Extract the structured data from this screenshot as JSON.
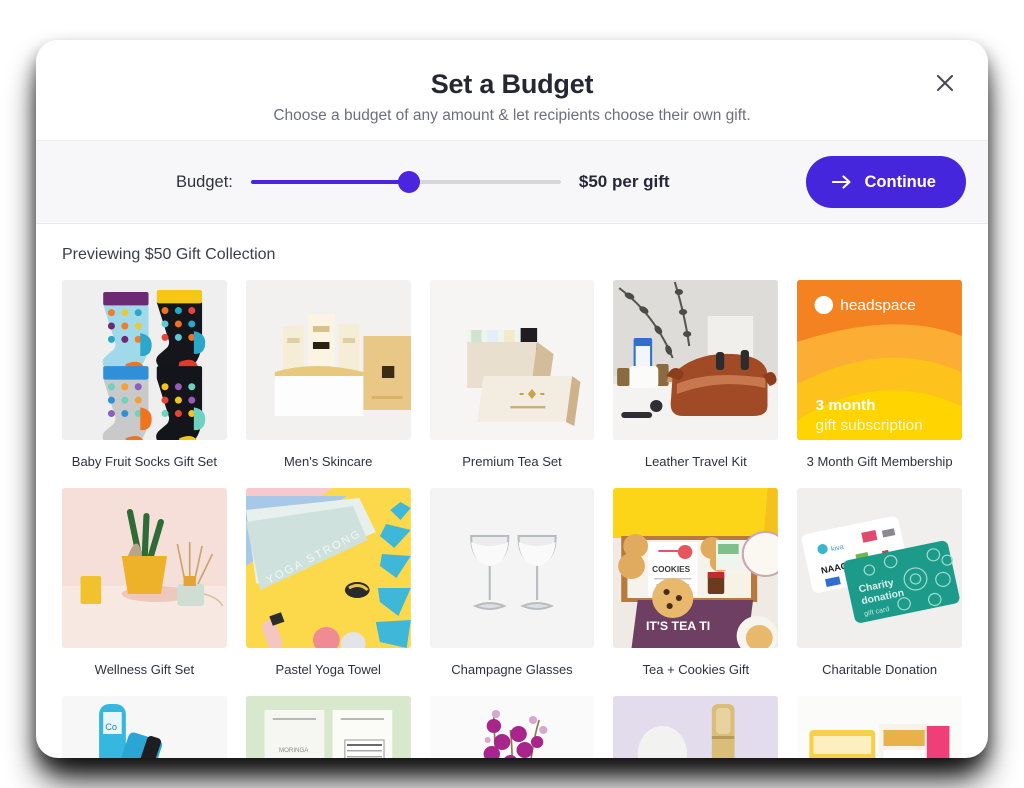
{
  "modal": {
    "title": "Set a Budget",
    "subtitle": "Choose a budget of any amount & let recipients choose their own gift.",
    "close_icon": "close-icon"
  },
  "budget": {
    "label": "Budget:",
    "value_text": "$50 per gift",
    "amount": 50,
    "slider_percent": 51,
    "accent_color": "#4c24e0",
    "track_color": "#d7d7da"
  },
  "continue": {
    "label": "Continue",
    "icon": "arrow-right-icon",
    "color": "#4526dd"
  },
  "preview": {
    "title": "Previewing $50 Gift Collection"
  },
  "gifts": [
    {
      "name": "Baby Fruit Socks Gift Set",
      "art": "socks"
    },
    {
      "name": "Men's Skincare",
      "art": "skincare"
    },
    {
      "name": "Premium Tea Set",
      "art": "tea"
    },
    {
      "name": "Leather Travel Kit",
      "art": "dopp"
    },
    {
      "name": "3 Month Gift Membership",
      "art": "headspace"
    },
    {
      "name": "Wellness Gift Set",
      "art": "wellness"
    },
    {
      "name": "Pastel Yoga Towel",
      "art": "yoga"
    },
    {
      "name": "Champagne Glasses",
      "art": "glasses"
    },
    {
      "name": "Tea + Cookies Gift",
      "art": "cookies"
    },
    {
      "name": "Charitable Donation",
      "art": "charity"
    }
  ],
  "gifts_row3": [
    {
      "art": "bluetube"
    },
    {
      "art": "greenpack"
    },
    {
      "art": "orchid"
    },
    {
      "art": "perfume"
    },
    {
      "art": "snacks"
    }
  ],
  "headspace_card": {
    "brand": "headspace",
    "line1": "3 month",
    "line2": "gift subscription"
  },
  "yoga_card": {
    "text": "YOGA STRONG"
  },
  "cookies_card": {
    "text1": "COOKIES",
    "text2": "IT'S TEA TI"
  },
  "charity_card": {
    "text1": "Charity",
    "text2": "donation",
    "text3": "gift",
    "text4": "card",
    "text5": "NAACP"
  }
}
